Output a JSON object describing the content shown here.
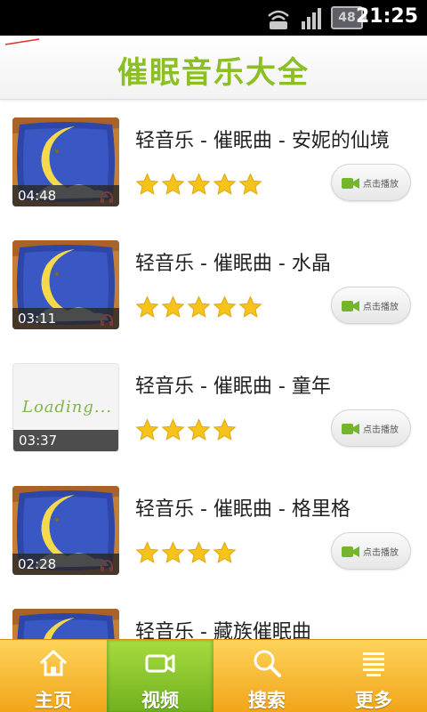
{
  "status_bar": {
    "time": "21:25",
    "battery_label": "48",
    "icons": [
      "wifi-icon",
      "signal-icon",
      "battery-icon"
    ]
  },
  "header": {
    "title": "催眠音乐大全"
  },
  "list": {
    "items": [
      {
        "title": "轻音乐 - 催眠曲 - 安妮的仙境",
        "duration": "04:48",
        "rating": 5,
        "thumbnail": "moon-pillow",
        "play_label": "点击播放"
      },
      {
        "title": "轻音乐 - 催眠曲 - 水晶",
        "duration": "03:11",
        "rating": 5,
        "thumbnail": "moon-pillow",
        "play_label": "点击播放"
      },
      {
        "title": "轻音乐 - 催眠曲 - 童年",
        "duration": "03:37",
        "rating": 4,
        "thumbnail": "loading",
        "loading_text": "Loading...",
        "play_label": "点击播放"
      },
      {
        "title": "轻音乐 - 催眠曲 - 格里格",
        "duration": "02:28",
        "rating": 4,
        "thumbnail": "moon-pillow",
        "play_label": "点击播放"
      },
      {
        "title": "轻音乐 - 藏族催眠曲",
        "duration": "",
        "rating": 0,
        "thumbnail": "moon-pillow",
        "play_label": ""
      }
    ]
  },
  "bottom_nav": {
    "items": [
      {
        "label": "主页",
        "icon": "home-icon",
        "active": false
      },
      {
        "label": "视频",
        "icon": "video-camera-icon",
        "active": true
      },
      {
        "label": "搜索",
        "icon": "search-icon",
        "active": false
      },
      {
        "label": "更多",
        "icon": "more-icon",
        "active": false
      }
    ]
  },
  "colors": {
    "title_green": "#8cbf24",
    "star_yellow": "#f6c31c",
    "nav_orange": "#f1a51a",
    "nav_active_green": "#6fb11f",
    "status_bar_black": "#000000"
  }
}
